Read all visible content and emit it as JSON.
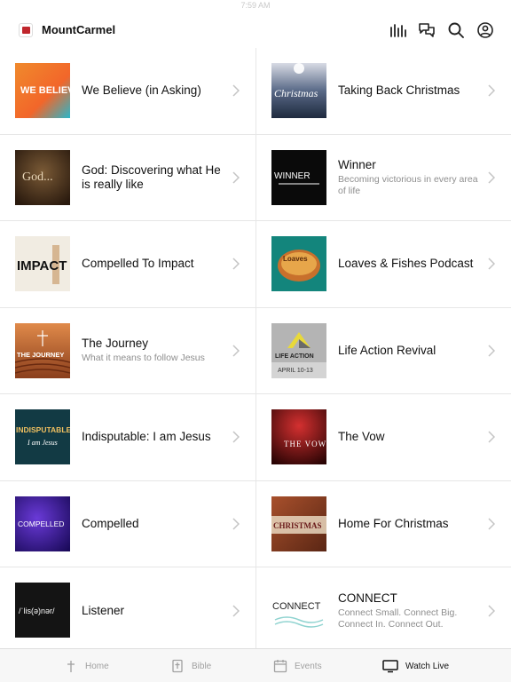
{
  "status": {
    "time": "7:59 AM"
  },
  "header": {
    "title": "MountCarmel"
  },
  "icons": {
    "audio": "audio-bars-icon",
    "chat": "chat-bubbles-icon",
    "search": "search-icon",
    "account": "account-icon"
  },
  "series": {
    "left": [
      {
        "title": "We Believe (in Asking)",
        "subtitle": "",
        "thumb_text": "WE BELIEVE"
      },
      {
        "title": "God: Discovering what He is really like",
        "subtitle": "",
        "thumb_text": "God..."
      },
      {
        "title": "Compelled To Impact",
        "subtitle": "",
        "thumb_text": "IMPACT"
      },
      {
        "title": "The Journey",
        "subtitle": "What it means to follow Jesus",
        "thumb_text": "THE JOURNEY"
      },
      {
        "title": "Indisputable: I am Jesus",
        "subtitle": "",
        "thumb_text": "INDISPUTABLE"
      },
      {
        "title": "Compelled",
        "subtitle": "",
        "thumb_text": "COMPELLED"
      },
      {
        "title": "Listener",
        "subtitle": "",
        "thumb_text": "/ˈlis(ə)nər/"
      }
    ],
    "right": [
      {
        "title": "Taking Back Christmas",
        "subtitle": "",
        "thumb_text": "Christmas"
      },
      {
        "title": "Winner",
        "subtitle": "Becoming victorious in every area of life",
        "thumb_text": "WINNER"
      },
      {
        "title": "Loaves & Fishes Podcast",
        "subtitle": "",
        "thumb_text": "Loaves"
      },
      {
        "title": "Life Action Revival",
        "subtitle": "",
        "thumb_text": "LIFE ACTION",
        "thumb_text2": "APRIL 10-13"
      },
      {
        "title": "The Vow",
        "subtitle": "",
        "thumb_text": "THE VOW"
      },
      {
        "title": "Home For Christmas",
        "subtitle": "",
        "thumb_text": "CHRISTMAS"
      },
      {
        "title": "CONNECT",
        "subtitle": "Connect Small. Connect Big. Connect In. Connect Out.",
        "thumb_text": "CONNECT"
      }
    ]
  },
  "tabs": [
    {
      "label": "Home",
      "icon": "cross-icon",
      "active": false
    },
    {
      "label": "Bible",
      "icon": "bible-icon",
      "active": false
    },
    {
      "label": "Events",
      "icon": "calendar-icon",
      "active": false
    },
    {
      "label": "Watch Live",
      "icon": "tv-icon",
      "active": true
    }
  ],
  "colors": {
    "active_tab": "#111111",
    "inactive_tab": "#a0a0a0",
    "chevron": "#c4c4c4",
    "logo_red": "#c0262d"
  }
}
